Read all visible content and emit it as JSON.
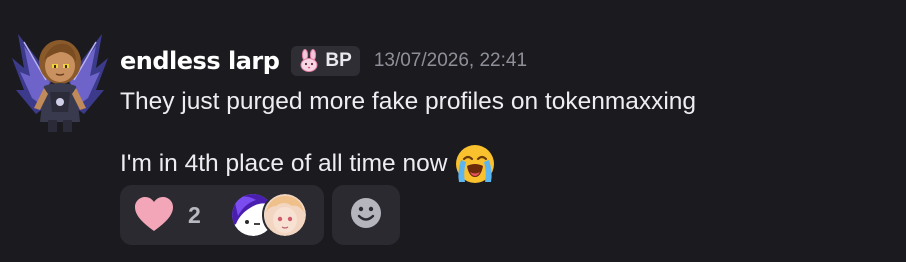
{
  "message": {
    "author": "endless larp",
    "tag": {
      "icon": "bunny-icon",
      "label": "BP"
    },
    "timestamp": "13/07/2026, 22:41",
    "lines": [
      "They just purged more fake profiles on tokenmaxxing",
      "I'm in 4th place of all time now"
    ],
    "inline_emoji": "loudly-crying-face-icon"
  },
  "reactions": [
    {
      "icon": "heart-icon",
      "count": "2",
      "color": "#f4a6b9"
    }
  ],
  "add_reaction": {
    "icon": "add-reaction-smiley-icon"
  },
  "colors": {
    "background": "#1b1b1f",
    "reaction_bg": "#2a2a30",
    "tag_bg": "#2e2e34",
    "timestamp": "#8f8f99"
  }
}
